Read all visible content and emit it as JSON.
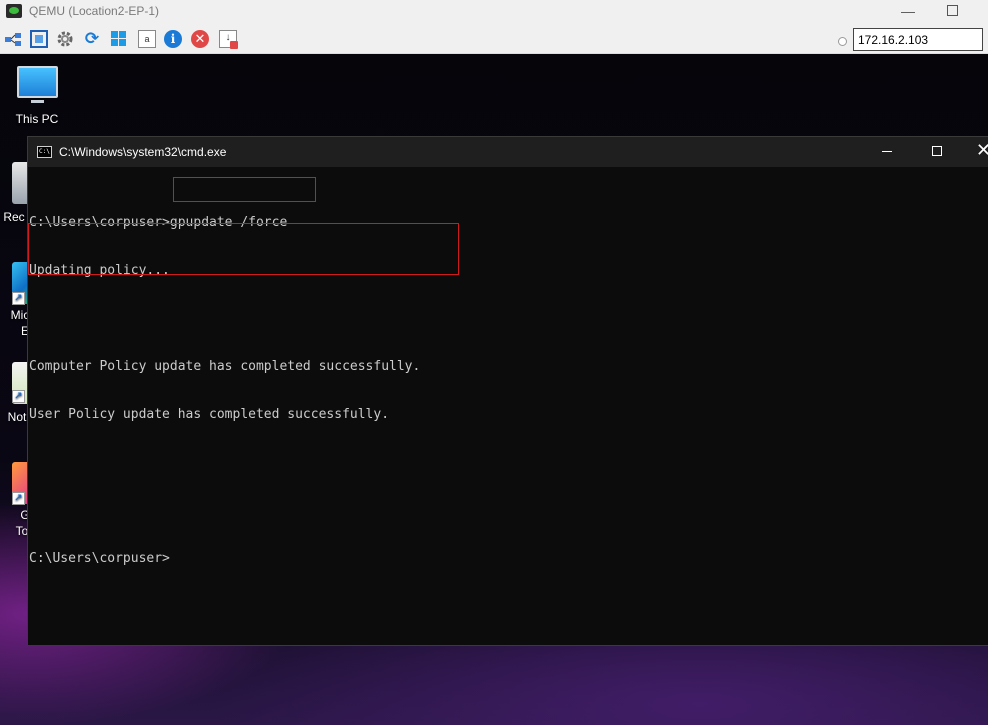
{
  "qemu": {
    "title": "QEMU (Location2-EP-1)",
    "ip_address": "172.16.2.103",
    "toolbar_icons": [
      "network-icon",
      "fullscreen-icon",
      "settings-gear-icon",
      "refresh-icon",
      "windows-icon",
      "document-icon",
      "info-icon",
      "close-red-icon",
      "download-icon"
    ]
  },
  "desktop": {
    "icons": [
      {
        "label": "This PC",
        "icon": "monitor-icon"
      },
      {
        "label": "Rec",
        "icon": "recycle-bin-icon"
      },
      {
        "label": "Mic",
        "label2": "E",
        "icon": "edge-icon"
      },
      {
        "label": "Not",
        "icon": "notepad-icon"
      },
      {
        "label": "G",
        "label2": "To",
        "icon": "app-icon"
      }
    ]
  },
  "cmd": {
    "title": "C:\\Windows\\system32\\cmd.exe",
    "icon_text": "C:\\",
    "lines": {
      "prompt1": "C:\\Users\\corpuser>",
      "command": "gpupdate /force",
      "updating": "Updating policy...",
      "computer_policy": "Computer Policy update has completed successfully.",
      "user_policy": "User Policy update has completed successfully.",
      "prompt2": "C:\\Users\\corpuser>"
    }
  },
  "colors": {
    "terminal_bg": "#0c0c0c",
    "terminal_text": "#cccccc",
    "highlight_box": "#d11a1a"
  }
}
